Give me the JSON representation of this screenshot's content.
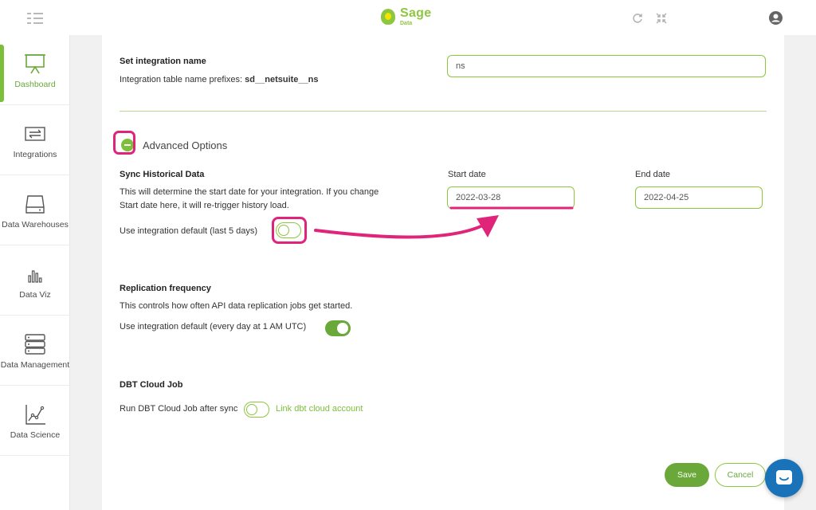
{
  "header": {
    "brand_name": "Sage",
    "brand_sub": "Data",
    "icons": [
      "menu-toggle-icon",
      "refresh-icon",
      "collapse-icon",
      "user-icon"
    ]
  },
  "sidebar": {
    "items": [
      {
        "label": "Dashboard",
        "icon": "dashboard-icon",
        "active": true
      },
      {
        "label": "Integrations",
        "icon": "integrations-icon",
        "active": false
      },
      {
        "label": "Data Warehouses",
        "icon": "data-warehouse-icon",
        "active": false
      },
      {
        "label": "Data Viz",
        "icon": "data-viz-icon",
        "active": false
      },
      {
        "label": "Data Management",
        "icon": "data-management-icon",
        "active": false
      },
      {
        "label": "Data Science",
        "icon": "data-science-icon",
        "active": false
      }
    ]
  },
  "integration_name": {
    "heading": "Set integration name",
    "prefix_label": "Integration table name prefixes:",
    "prefix_value": "sd__netsuite__ns",
    "input_value": "ns"
  },
  "advanced": {
    "label": "Advanced Options"
  },
  "sync": {
    "heading": "Sync Historical Data",
    "description_line1": "This will determine the start date for your integration. If you change",
    "description_line2": "Start date here, it will re-trigger history load.",
    "default_label": "Use integration default (last 5 days)",
    "default_enabled": false,
    "start_label": "Start date",
    "start_value": "2022-03-28",
    "end_label": "End date",
    "end_value": "2022-04-25"
  },
  "replication": {
    "heading": "Replication frequency",
    "description": "This controls how often API data replication jobs get started.",
    "default_label": "Use integration default (every day at 1 AM UTC)",
    "default_enabled": true
  },
  "dbt": {
    "heading": "DBT Cloud Job",
    "run_label": "Run DBT Cloud Job after sync",
    "run_enabled": false,
    "link_label": "Link dbt cloud account"
  },
  "actions": {
    "save": "Save",
    "cancel": "Cancel"
  },
  "colors": {
    "accent": "#7cbf3b",
    "highlight": "#e0247a",
    "chat": "#1a73b8"
  }
}
